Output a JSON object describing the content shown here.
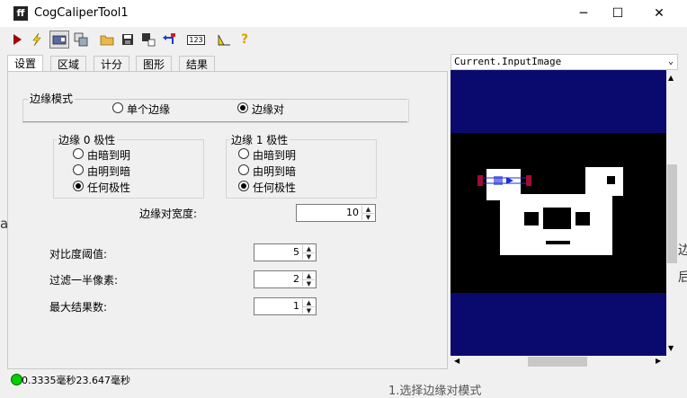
{
  "window": {
    "title": "CogCaliperTool1",
    "icon": "ff"
  },
  "window_controls": {
    "minimize": "─",
    "maximize": "☐",
    "close": "✕"
  },
  "toolbar": {
    "icons": [
      "run-icon",
      "electric-icon",
      "camera-icon",
      "show-image-icon",
      "open-icon",
      "save-icon",
      "reset-icon",
      "undo-icon",
      "table-icon",
      "grid-icon",
      "help-icon"
    ],
    "table_label": "123",
    "help_label": "?"
  },
  "tabs": [
    "设置",
    "区域",
    "计分",
    "图形",
    "结果"
  ],
  "settings": {
    "edge_mode": {
      "legend": "边缘模式",
      "options": [
        {
          "label": "单个边缘",
          "selected": false
        },
        {
          "label": "边缘对",
          "selected": true
        }
      ]
    },
    "edge0": {
      "legend": "边缘 0 极性",
      "options": [
        {
          "label": "由暗到明",
          "selected": false
        },
        {
          "label": "由明到暗",
          "selected": false
        },
        {
          "label": "任何极性",
          "selected": true
        }
      ]
    },
    "edge1": {
      "legend": "边缘 1 极性",
      "options": [
        {
          "label": "由暗到明",
          "selected": false
        },
        {
          "label": "由明到暗",
          "selected": false
        },
        {
          "label": "任何极性",
          "selected": true
        }
      ]
    },
    "pair_width": {
      "label": "边缘对宽度:",
      "value": "10"
    },
    "contrast": {
      "label": "对比度阈值:",
      "value": "5"
    },
    "filter": {
      "label": "过滤一半像素:",
      "value": "2"
    },
    "max_results": {
      "label": "最大结果数:",
      "value": "1"
    }
  },
  "status": {
    "text": "0.3335毫秒23.647毫秒",
    "indicator_color": "#00d000"
  },
  "image": {
    "dropdown_value": "Current.InputImage",
    "colors": {
      "band": "#0a0a6e",
      "black": "#000000",
      "white": "#ffffff",
      "caliper": "#1a2fd6",
      "handle": "#b0103a"
    }
  },
  "background": {
    "left_text": "a",
    "right_text_a": "边",
    "right_text_b": "后",
    "bottom_text": "1.选择边缘对模式"
  }
}
